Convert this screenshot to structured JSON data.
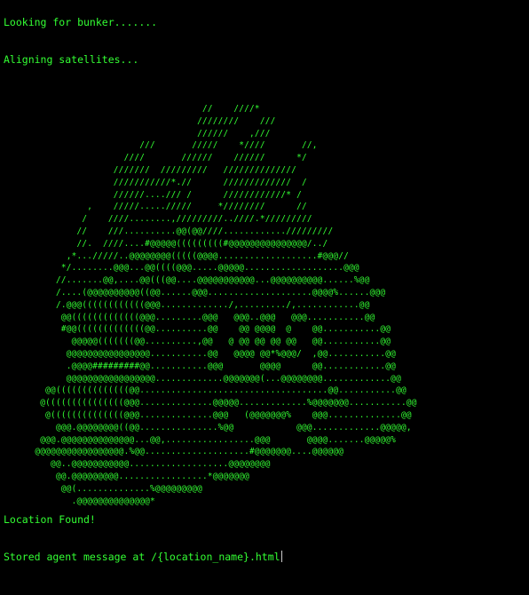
{
  "terminal": {
    "colors": {
      "background": "#000000",
      "text": "#33ff33",
      "cursor": "#cccccc"
    },
    "lines": {
      "searching": "Looking for bunker.......",
      "aligning": "Aligning satellites...",
      "found": "Location Found!",
      "stored": "Stored agent message at /{location_name}.html"
    },
    "ascii_art": "                                      //    ////*\n                                     ////////    ///\n                                     //////    ,///\n                          ///       /////    *////       //,\n                       ////       //////    //////      */\n                     ///////  /////////   //////////////\n                     ///////////*.//      /////////////  /\n                     //////..../// /      ////////////* /\n                ,    /////...../////     *////////      //\n               /    ////........,/////////..////.*/////////\n              //    ///..........@@(@@////............/////////\n              //.  ////....#@@@@@(((((((((#@@@@@@@@@@@@@@@/../\n            ,*.../////..@@@@@@@@(((((@@@@...................#@@@//\n           */........@@@...@@((((@@@.....@@@@@...................@@@\n          //.......@@,....@@(((@@....@@@@@@@@@@@...@@@@@@@@@@......%@@\n          /....(@@@@@@@@@@((@@......@@@....................@@@@%......@@@\n          /.@@@((((((((((((@@@............./,........./,............@@\n           @@(((((((((((((@@@.........@@@   @@@..@@@   @@@...........@@\n           #@@(((((((((((((@@..........@@    @@ @@@@  @    @@...........@@\n             @@@@@(((((((@@..........,@@   @ @@ @@ @@ @@   @@...........@@\n            @@@@@@@@@@@@@@@@...........@@   @@@@ @@*%@@@/  ,@@...........@@\n            .@@@@#########@@...........@@@       @@@@      @@............@@\n            @@@@@@@@@@@@@@@@@.............@@@@@@@(...@@@@@@@@.............@@\n        @@((((((((((((((@@....................................@@...........@@\n       @(((((((((((((((@@@..............@@@@@.............%@@@@@@@...........@@\n        @((((((((((((((@@@..............@@@   (@@@@@@@%    @@@..............@@\n          @@@.@@@@@@@@((@@...............%@@            @@@.............@@@@@,\n       @@@.@@@@@@@@@@@@@@...@@,.................@@@       @@@@.......@@@@@%\n      @@@@@@@@@@@@@@@@@.%@@....................#@@@@@@@....@@@@@@\n         @@..@@@@@@@@@@@...................@@@@@@@@\n          @@.@@@@@@@@@.................*@@@@@@@\n           @@(..............%@@@@@@@@@\n             .@@@@@@@@@@@@@@*"
  }
}
